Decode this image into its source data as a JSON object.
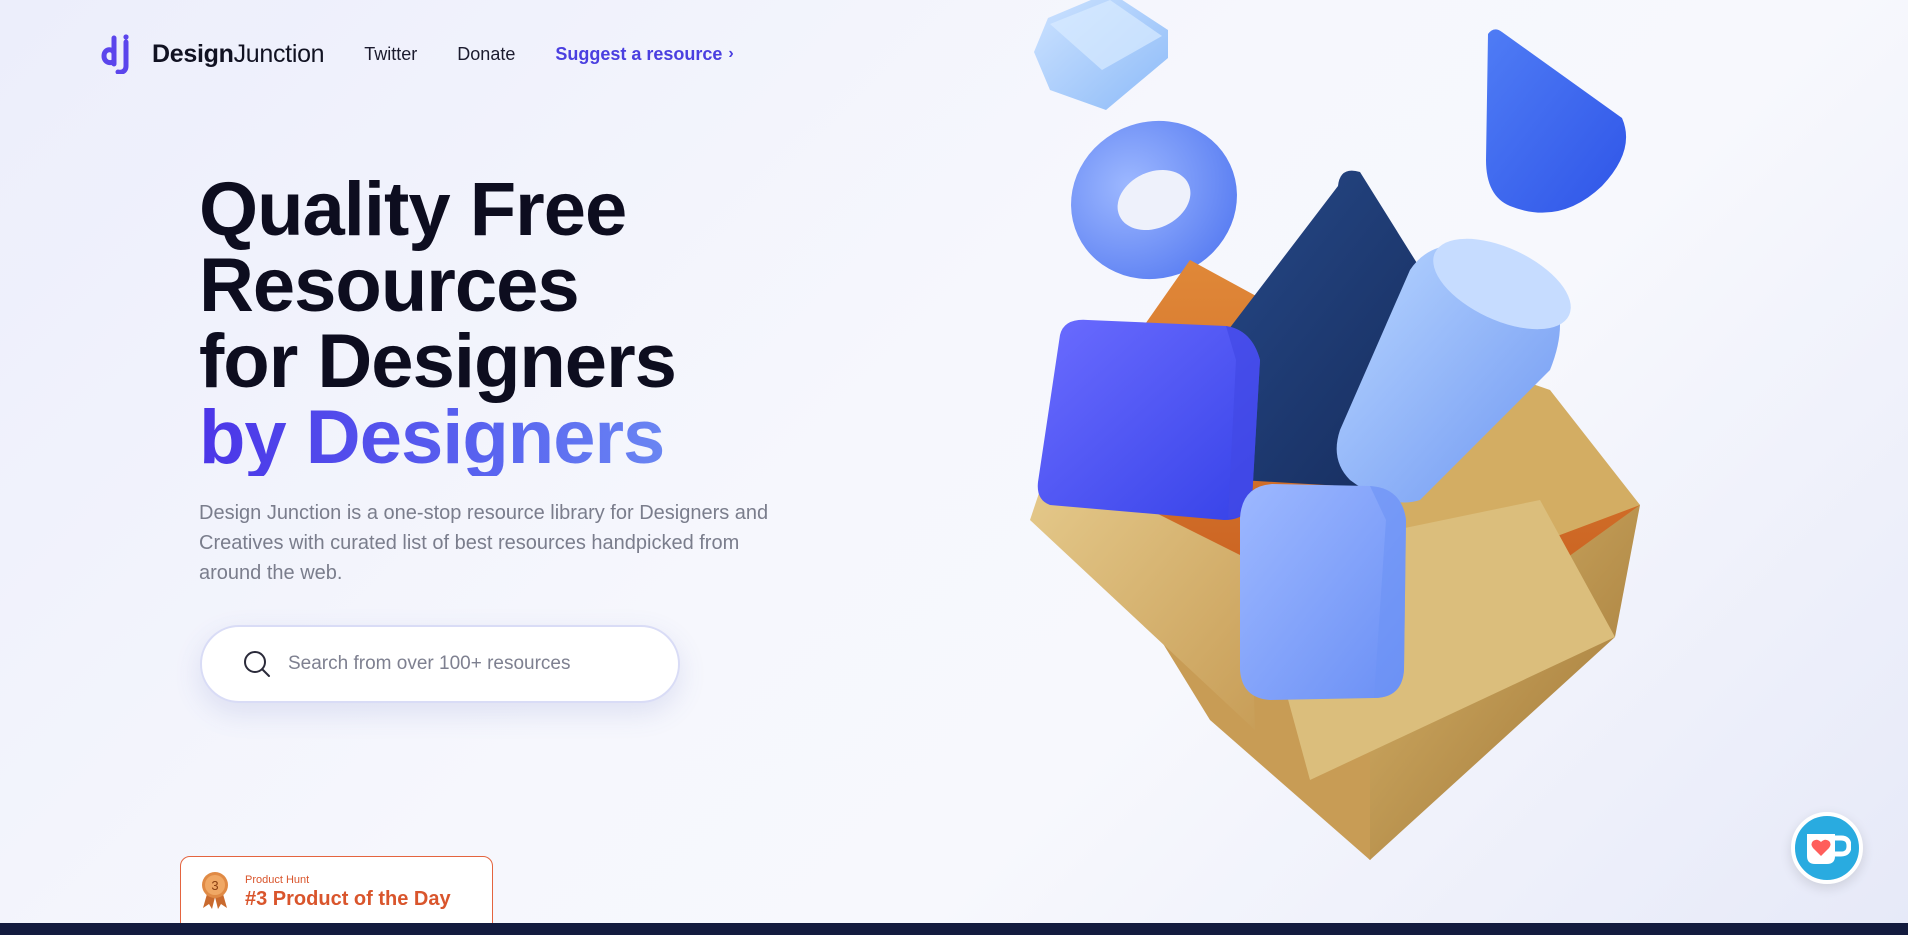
{
  "nav": {
    "brand_bold": "Design",
    "brand_light": "Junction",
    "logo_mark": "dj",
    "links": [
      "Twitter",
      "Donate"
    ],
    "suggest_label": "Suggest a resource",
    "suggest_chevron": "›"
  },
  "hero": {
    "line1": "Quality Free",
    "line2": "Resources",
    "line3": "for Designers",
    "line4": "by Designers",
    "description": "Design Junction is a one-stop resource library for Designers and Creatives with curated list of best resources handpicked from around the web."
  },
  "search": {
    "placeholder": "Search from over 100+ resources",
    "icon": "search-icon"
  },
  "product_hunt": {
    "label": "Product Hunt",
    "rank_text": "#3 Product of the Day",
    "medal_number": "3"
  },
  "colors": {
    "accent": "#4a3fe0",
    "gradient_start": "#4b35e8",
    "gradient_end": "#7aa4f5",
    "product_hunt": "#d9552c",
    "kofi": "#29abe0",
    "footer_bar": "#131b3e"
  },
  "kofi_button": {
    "icon": "kofi-cup-heart-icon"
  }
}
